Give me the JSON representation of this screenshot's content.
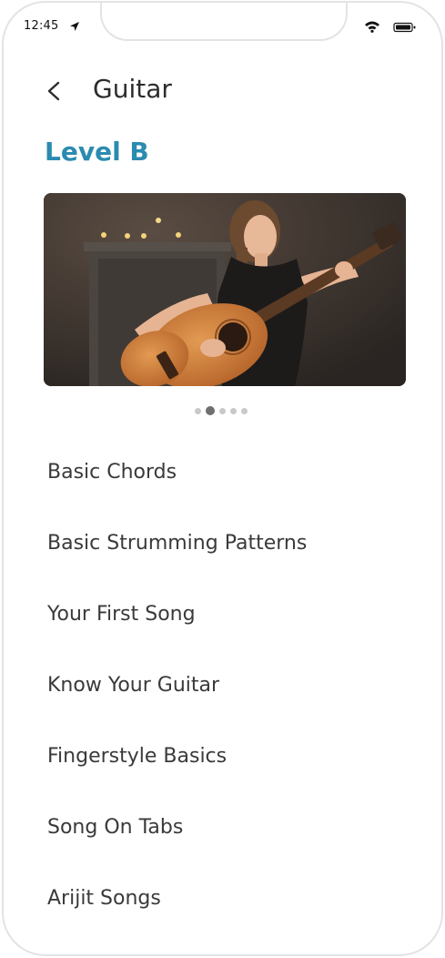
{
  "status_bar": {
    "time": "12:45",
    "icons": [
      "location-arrow-icon",
      "wifi-icon",
      "battery-icon"
    ]
  },
  "header": {
    "back_icon": "chevron-left-icon",
    "title": "Guitar"
  },
  "level": {
    "title": "Level B"
  },
  "carousel": {
    "image": "girl-playing-acoustic-guitar",
    "slide_count": 5,
    "active_index": 1
  },
  "lessons": [
    {
      "label": "Basic Chords"
    },
    {
      "label": "Basic Strumming Patterns"
    },
    {
      "label": "Your First Song"
    },
    {
      "label": "Know Your Guitar"
    },
    {
      "label": "Fingerstyle Basics"
    },
    {
      "label": "Song On Tabs"
    },
    {
      "label": "Arijit Songs"
    }
  ],
  "colors": {
    "accent": "#2b8bb0",
    "text": "#3a3a3a",
    "frame": "#e3e3e3"
  }
}
